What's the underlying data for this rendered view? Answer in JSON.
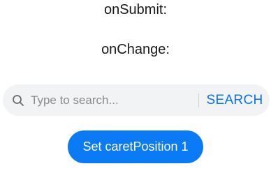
{
  "labels": {
    "on_submit": "onSubmit:",
    "on_change": "onChange:"
  },
  "search": {
    "icon": "search-icon",
    "placeholder": "Type to search...",
    "value": "",
    "button_label": "SEARCH",
    "background_color": "#f1f3f5",
    "accent_color": "#0a72ee"
  },
  "actions": {
    "set_caret_label": "Set caretPosition 1",
    "button_color": "#0a7bf5"
  }
}
